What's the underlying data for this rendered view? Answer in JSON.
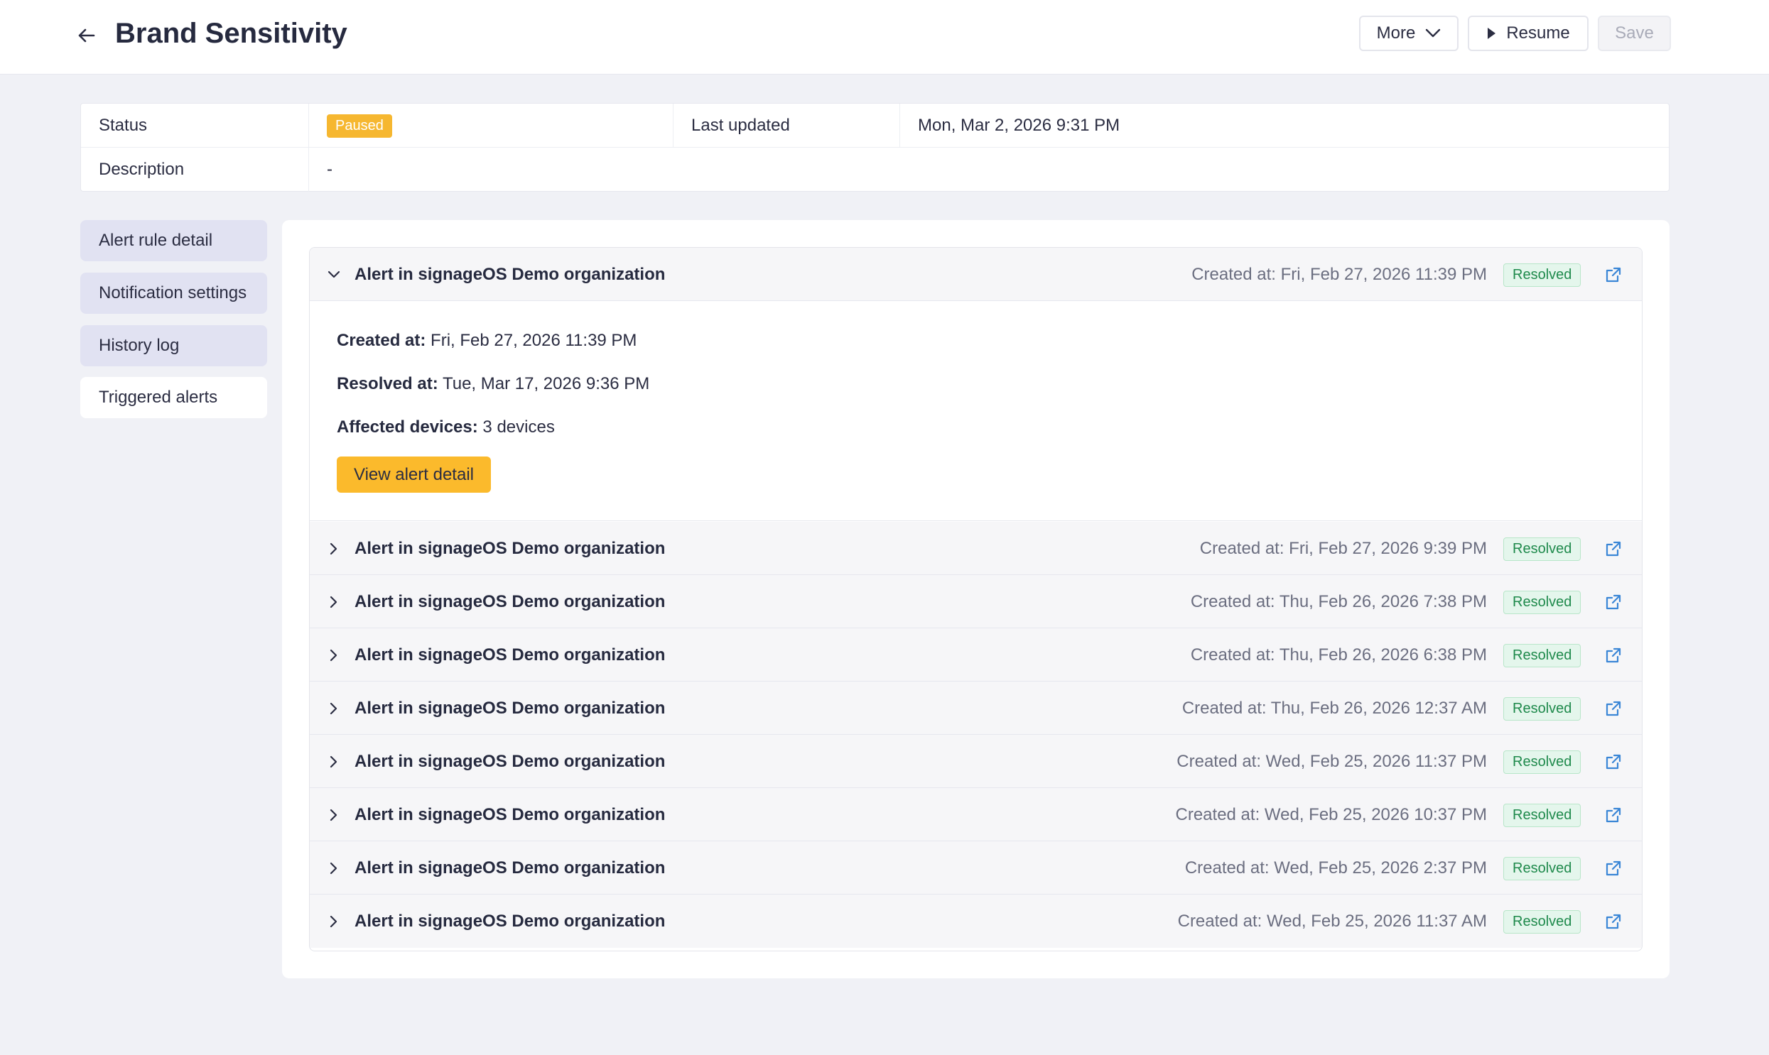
{
  "header": {
    "title": "Brand Sensitivity",
    "more_label": "More",
    "resume_label": "Resume",
    "save_label": "Save"
  },
  "info": {
    "status_label": "Status",
    "status_value": "Paused",
    "last_updated_label": "Last updated",
    "last_updated_value": "Mon, Mar 2, 2026 9:31 PM",
    "description_label": "Description",
    "description_value": "-"
  },
  "sidebar": {
    "items": [
      {
        "label": "Alert rule detail"
      },
      {
        "label": "Notification settings"
      },
      {
        "label": "History log"
      },
      {
        "label": "Triggered alerts"
      }
    ]
  },
  "alerts": [
    {
      "title": "Alert in signageOS Demo organization",
      "created": "Created at: Fri, Feb 27, 2026 11:39 PM",
      "status": "Resolved"
    },
    {
      "title": "Alert in signageOS Demo organization",
      "created": "Created at: Fri, Feb 27, 2026 9:39 PM",
      "status": "Resolved"
    },
    {
      "title": "Alert in signageOS Demo organization",
      "created": "Created at: Thu, Feb 26, 2026 7:38 PM",
      "status": "Resolved"
    },
    {
      "title": "Alert in signageOS Demo organization",
      "created": "Created at: Thu, Feb 26, 2026 6:38 PM",
      "status": "Resolved"
    },
    {
      "title": "Alert in signageOS Demo organization",
      "created": "Created at: Thu, Feb 26, 2026 12:37 AM",
      "status": "Resolved"
    },
    {
      "title": "Alert in signageOS Demo organization",
      "created": "Created at: Wed, Feb 25, 2026 11:37 PM",
      "status": "Resolved"
    },
    {
      "title": "Alert in signageOS Demo organization",
      "created": "Created at: Wed, Feb 25, 2026 10:37 PM",
      "status": "Resolved"
    },
    {
      "title": "Alert in signageOS Demo organization",
      "created": "Created at: Wed, Feb 25, 2026 2:37 PM",
      "status": "Resolved"
    },
    {
      "title": "Alert in signageOS Demo organization",
      "created": "Created at: Wed, Feb 25, 2026 11:37 AM",
      "status": "Resolved"
    }
  ],
  "expanded": {
    "created_label": "Created at:",
    "created_value": "Fri, Feb 27, 2026 11:39 PM",
    "resolved_label": "Resolved at:",
    "resolved_value": "Tue, Mar 17, 2026 9:36 PM",
    "affected_label": "Affected devices:",
    "affected_value": "3 devices",
    "button_label": "View alert detail"
  },
  "colors": {
    "accent": "#fbba2c",
    "paused": "#f6b730",
    "resolved_bg": "#e4f6ec",
    "resolved_text": "#1f8a4c",
    "link_icon": "#3a86d6",
    "sidebar_inactive": "#e1e2f2"
  },
  "icons": {
    "back": "arrow-left-icon",
    "more": "chevron-down-icon",
    "resume": "play-icon",
    "expand": "chevron-right-icon",
    "collapse": "chevron-down-icon",
    "external": "external-link-icon"
  }
}
